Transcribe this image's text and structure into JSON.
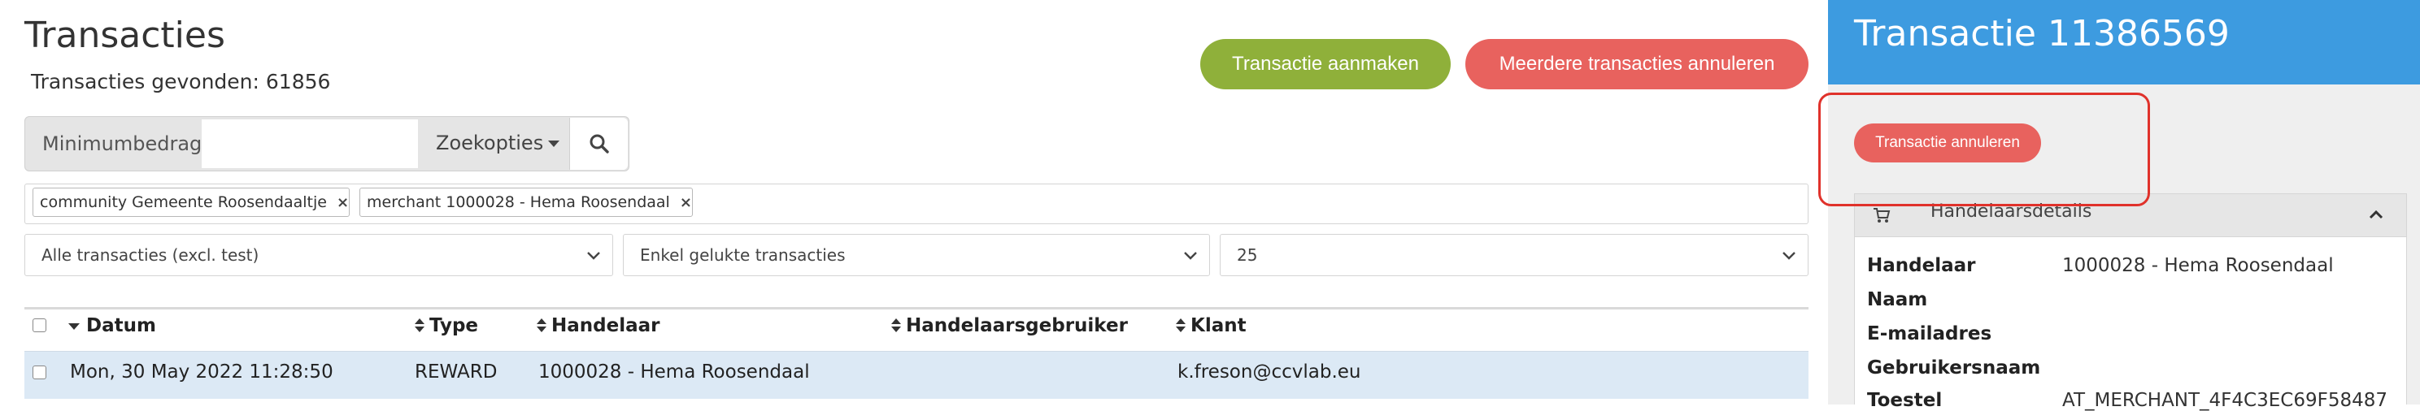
{
  "page": {
    "title": "Transacties",
    "count_text": "Transacties gevonden: 61856"
  },
  "actions": {
    "create_label": "Transactie aanmaken",
    "cancel_multiple_label": "Meerdere transacties annuleren"
  },
  "search": {
    "label": "Minimumbedrag",
    "value": "",
    "options_label": "Zoekopties"
  },
  "filters": {
    "tags": [
      {
        "label": "community Gemeente Roosendaaltje",
        "remove": "×"
      },
      {
        "label": "merchant 1000028 - Hema Roosendaal",
        "remove": "×"
      }
    ],
    "scope": "Alle transacties (excl. test)",
    "status": "Enkel gelukte transacties",
    "page_size": "25"
  },
  "table": {
    "columns": [
      "Datum",
      "Type",
      "Handelaar",
      "Handelaarsgebruiker",
      "Klant"
    ],
    "rows": [
      {
        "date": "Mon, 30 May 2022 11:28:50",
        "type": "REWARD",
        "merchant": "1000028 - Hema Roosendaal",
        "merchant_user": "",
        "customer": "k.freson@ccvlab.eu"
      }
    ]
  },
  "side_panel": {
    "title": "Transactie 11386569",
    "cancel_label": "Transactie annuleren",
    "card_title": "Handelaarsdetails",
    "fields": [
      {
        "label": "Handelaar",
        "value": "1000028 - Hema Roosendaal"
      },
      {
        "label": "Naam",
        "value": ""
      },
      {
        "label": "E-mailadres",
        "value": ""
      },
      {
        "label": "Gebruikersnaam",
        "value": ""
      },
      {
        "label": "Toestel",
        "value": "AT_MERCHANT_4F4C3EC69F58487"
      }
    ]
  },
  "colors": {
    "accent_blue": "#3d9be0",
    "green": "#8fb03a",
    "red": "#e8625e",
    "highlight": "#e0322b",
    "row_selected": "#dce9f5"
  },
  "icons": [
    "search-icon",
    "caret-down-icon",
    "close-icon",
    "chevron-down-icon",
    "sort-icon",
    "cart-icon",
    "chevron-up-icon"
  ]
}
